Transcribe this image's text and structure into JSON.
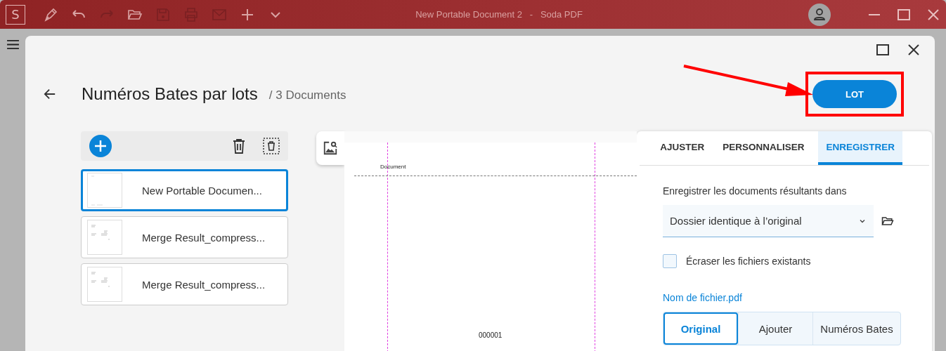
{
  "app": {
    "logo": "S",
    "title": "New Portable Document 2   -   Soda PDF"
  },
  "dialog": {
    "title": "Numéros Bates par lots",
    "subtitle": "/ 3 Documents",
    "primary_button": "LOT",
    "documents": [
      {
        "name": "New Portable Documen...",
        "selected": true
      },
      {
        "name": "Merge Result_compress...",
        "selected": false
      },
      {
        "name": "Merge Result_compress...",
        "selected": false
      }
    ],
    "preview": {
      "header_text": "Document",
      "footer_text": "000001"
    },
    "tabs": [
      {
        "label": "AJUSTER",
        "selected": false
      },
      {
        "label": "PERSONNALISER",
        "selected": false
      },
      {
        "label": "ENREGISTRER",
        "selected": true
      }
    ],
    "save_label": "Enregistrer les documents résultants dans",
    "folder_select": {
      "value": "Dossier identique à l’original"
    },
    "overwrite": {
      "label": "Écraser les fichiers existants",
      "checked": false
    },
    "filename_label": "Nom de fichier.pdf",
    "name_options": [
      {
        "label": "Original",
        "selected": true
      },
      {
        "label": "Ajouter",
        "selected": false
      },
      {
        "label": "Numéros Bates",
        "selected": false
      }
    ]
  }
}
